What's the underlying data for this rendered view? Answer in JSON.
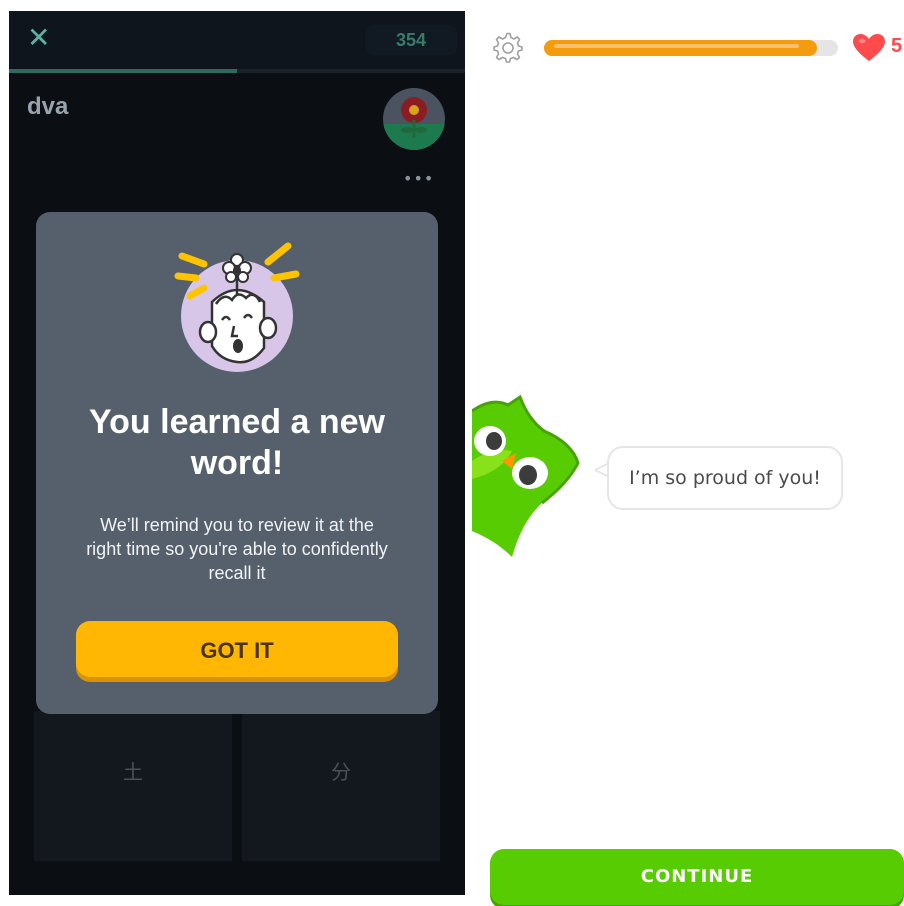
{
  "left_screen": {
    "score": "354",
    "progress": 0.5,
    "word": "dva",
    "tiles": [
      {
        "char": "土"
      },
      {
        "char": "分"
      }
    ],
    "modal": {
      "title": "You learned a new word!",
      "body": "We’ll remind you to review it at the right time so you're able to confidently recall it",
      "button": "GOT IT"
    },
    "colors": {
      "button": "#ffb703",
      "modal": "#56606d",
      "background": "#0b0f14"
    }
  },
  "right_screen": {
    "progress": 0.93,
    "lives": "5",
    "speech": "I’m so proud of you!",
    "continue_button": "CONTINUE",
    "colors": {
      "progress": "#f49c0b",
      "heart": "#ff4b4b",
      "continue": "#58cc02",
      "owl": "#58cc02"
    }
  }
}
